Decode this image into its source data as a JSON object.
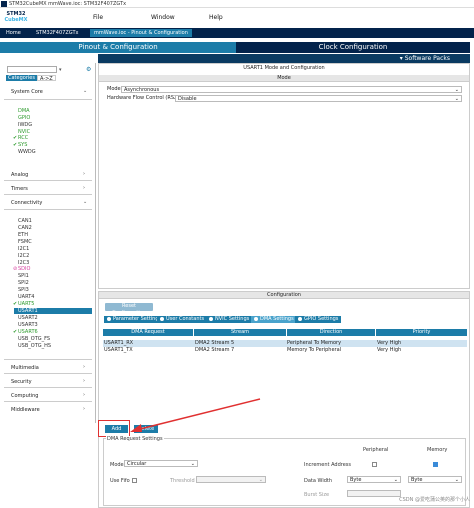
{
  "window": {
    "title": "STM32CubeMX mmWave.ioc: STM32F407ZGTx"
  },
  "logo": {
    "line1": "STM32",
    "line2": "CubeMX"
  },
  "menu": [
    "File",
    "Window",
    "Help"
  ],
  "breadcrumb": [
    "Home",
    "STM32F407ZGTx",
    "mmWave.ioc - Pinout & Configuration"
  ],
  "tabs": {
    "pinout": "Pinout & Configuration",
    "clock": "Clock Configuration"
  },
  "software_packs": "Software Packs",
  "sidebar": {
    "filter_tabs": [
      "Categories",
      "A->Z"
    ],
    "system_core": {
      "label": "System Core",
      "items": [
        {
          "label": "DMA",
          "state": "green"
        },
        {
          "label": "GPIO",
          "state": "green"
        },
        {
          "label": "IWDG",
          "state": "normal"
        },
        {
          "label": "NVIC",
          "state": "green"
        },
        {
          "label": "RCC",
          "state": "checked"
        },
        {
          "label": "SYS",
          "state": "checked"
        },
        {
          "label": "WWDG",
          "state": "normal"
        }
      ]
    },
    "analog": "Analog",
    "timers": "Timers",
    "connectivity": {
      "label": "Connectivity",
      "items": [
        {
          "label": "CAN1",
          "state": "normal"
        },
        {
          "label": "CAN2",
          "state": "normal"
        },
        {
          "label": "ETH",
          "state": "normal"
        },
        {
          "label": "FSMC",
          "state": "normal"
        },
        {
          "label": "I2C1",
          "state": "normal"
        },
        {
          "label": "I2C2",
          "state": "normal"
        },
        {
          "label": "I2C3",
          "state": "normal"
        },
        {
          "label": "SDIO",
          "state": "disabled"
        },
        {
          "label": "SPI1",
          "state": "normal"
        },
        {
          "label": "SPI2",
          "state": "normal"
        },
        {
          "label": "SPI3",
          "state": "normal"
        },
        {
          "label": "UART4",
          "state": "normal"
        },
        {
          "label": "UART5",
          "state": "checked"
        },
        {
          "label": "USART1",
          "state": "selected"
        },
        {
          "label": "USART2",
          "state": "normal"
        },
        {
          "label": "USART3",
          "state": "normal"
        },
        {
          "label": "USART6",
          "state": "checked"
        },
        {
          "label": "USB_OTG_FS",
          "state": "normal"
        },
        {
          "label": "USB_OTG_HS",
          "state": "normal"
        }
      ]
    },
    "more": [
      "Multimedia",
      "Security",
      "Computing",
      "Middleware"
    ]
  },
  "mode_panel": {
    "title": "USART1 Mode and Configuration",
    "section": "Mode",
    "mode_label": "Mode",
    "mode_value": "Asynchronous",
    "hfc_label": "Hardware Flow Control (RS232)",
    "hfc_value": "Disable"
  },
  "config_panel": {
    "title": "Configuration",
    "reset_button": "Reset Configuration",
    "tabs": [
      "Parameter Settings",
      "User Constants",
      "NVIC Settings",
      "DMA Settings",
      "GPIO Settings"
    ],
    "active_tab": 3,
    "table_headers": [
      "DMA Request",
      "Stream",
      "Direction",
      "Priority"
    ],
    "rows": [
      [
        "USART1_RX",
        "DMA2 Stream 5",
        "Peripheral To Memory",
        "Very High"
      ],
      [
        "USART1_TX",
        "DMA2 Stream 7",
        "Memory To Peripheral",
        "Very High"
      ]
    ],
    "add_button": "Add",
    "delete_button": "Delete",
    "request_settings": {
      "title": "DMA Request Settings",
      "peripheral_label": "Peripheral",
      "memory_label": "Memory",
      "mode_label": "Mode",
      "mode_value": "Circular",
      "increment_label": "Increment Address",
      "use_fifo_label": "Use Fifo",
      "threshold_label": "Threshold",
      "data_width_label": "Data Width",
      "peripheral_width": "Byte",
      "memory_width": "Byte",
      "burst_label": "Burst Size"
    }
  },
  "watermark": "CSDN @爱吃蒲公英的那个小人",
  "colors": {
    "accent": "#1c7ca8",
    "dark": "#03234b"
  }
}
